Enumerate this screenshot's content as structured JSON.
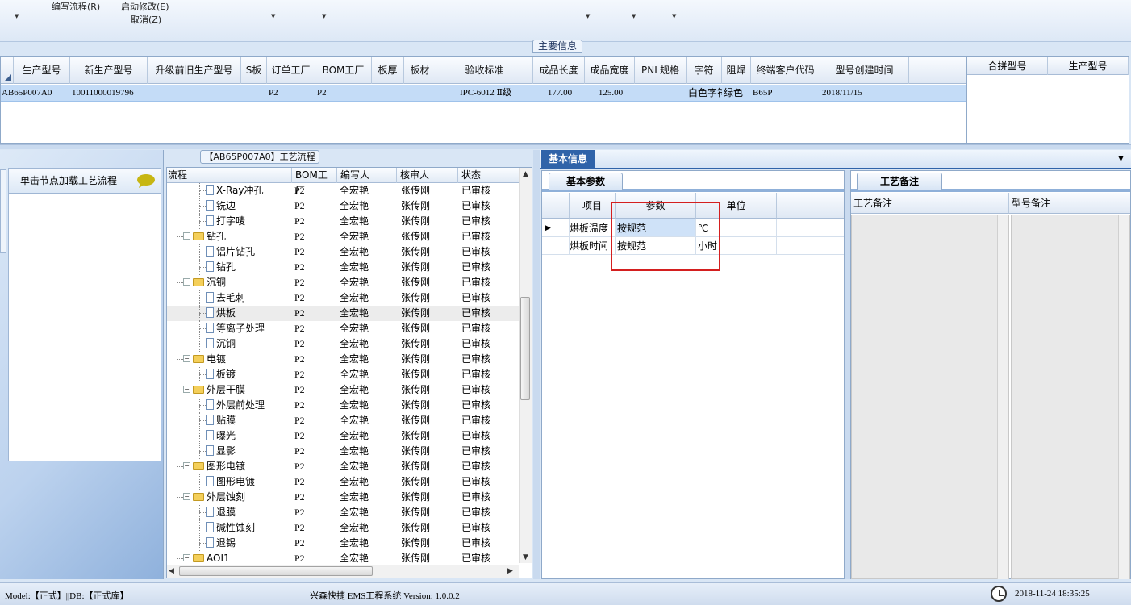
{
  "ribbon": {
    "menu1": "编写流程(R)",
    "menu2": "启动修改(E)",
    "menu3": "取消(Z)"
  },
  "main_info": {
    "section_title": "主要信息",
    "columns": [
      "生产型号",
      "新生产型号",
      "升级前旧生产型号",
      "S板",
      "订单工厂",
      "BOM工厂",
      "板厚",
      "板材",
      "验收标准",
      "成品长度",
      "成品宽度",
      "PNL规格",
      "字符",
      "阻焊",
      "终端客户代码",
      "型号创建时间"
    ],
    "row": {
      "c1": "AB65P007A0",
      "c2": "10011000019796",
      "c3": "",
      "c4": "",
      "c5": "P2",
      "c6": "P2",
      "c7": "",
      "c8": "",
      "c9": "IPC-6012 Ⅱ级",
      "c10": "177.00",
      "c11": "125.00",
      "c12": "",
      "c13": "白色字符",
      "c14": "绿色",
      "c15": "B65P",
      "c16": "2018/11/15"
    },
    "side_columns": [
      "合拼型号",
      "生产型号"
    ]
  },
  "left_panel": {
    "load_button": "单击节点加载工艺流程"
  },
  "tree": {
    "title": "【AB65P007A0】工艺流程",
    "columns": [
      "流程",
      "BOM工厂",
      "编写人",
      "核审人",
      "状态"
    ],
    "rows": [
      {
        "name": "X-Ray冲孔",
        "type": "leaf",
        "bom": "P2",
        "writer": "全宏艳",
        "reviewer": "张传刚",
        "status": "已审核"
      },
      {
        "name": "铣边",
        "type": "leaf",
        "bom": "P2",
        "writer": "全宏艳",
        "reviewer": "张传刚",
        "status": "已审核"
      },
      {
        "name": "打字唛",
        "type": "leaf",
        "bom": "P2",
        "writer": "全宏艳",
        "reviewer": "张传刚",
        "status": "已审核"
      },
      {
        "name": "钻孔",
        "type": "folder",
        "bom": "P2",
        "writer": "全宏艳",
        "reviewer": "张传刚",
        "status": "已审核"
      },
      {
        "name": "铝片钻孔",
        "type": "leaf",
        "bom": "P2",
        "writer": "全宏艳",
        "reviewer": "张传刚",
        "status": "已审核"
      },
      {
        "name": "钻孔",
        "type": "leaf",
        "bom": "P2",
        "writer": "全宏艳",
        "reviewer": "张传刚",
        "status": "已审核"
      },
      {
        "name": "沉铜",
        "type": "folder",
        "bom": "P2",
        "writer": "全宏艳",
        "reviewer": "张传刚",
        "status": "已审核"
      },
      {
        "name": "去毛刺",
        "type": "leaf",
        "bom": "P2",
        "writer": "全宏艳",
        "reviewer": "张传刚",
        "status": "已审核"
      },
      {
        "name": "烘板",
        "type": "leaf",
        "bom": "P2",
        "writer": "全宏艳",
        "reviewer": "张传刚",
        "status": "已审核",
        "selected": true
      },
      {
        "name": "等离子处理",
        "type": "leaf",
        "bom": "P2",
        "writer": "全宏艳",
        "reviewer": "张传刚",
        "status": "已审核"
      },
      {
        "name": "沉铜",
        "type": "leaf",
        "bom": "P2",
        "writer": "全宏艳",
        "reviewer": "张传刚",
        "status": "已审核"
      },
      {
        "name": "电镀",
        "type": "folder",
        "bom": "P2",
        "writer": "全宏艳",
        "reviewer": "张传刚",
        "status": "已审核"
      },
      {
        "name": "板镀",
        "type": "leaf",
        "bom": "P2",
        "writer": "全宏艳",
        "reviewer": "张传刚",
        "status": "已审核"
      },
      {
        "name": "外层干膜",
        "type": "folder",
        "bom": "P2",
        "writer": "全宏艳",
        "reviewer": "张传刚",
        "status": "已审核"
      },
      {
        "name": "外层前处理",
        "type": "leaf",
        "bom": "P2",
        "writer": "全宏艳",
        "reviewer": "张传刚",
        "status": "已审核"
      },
      {
        "name": "贴膜",
        "type": "leaf",
        "bom": "P2",
        "writer": "全宏艳",
        "reviewer": "张传刚",
        "status": "已审核"
      },
      {
        "name": "曝光",
        "type": "leaf",
        "bom": "P2",
        "writer": "全宏艳",
        "reviewer": "张传刚",
        "status": "已审核"
      },
      {
        "name": "显影",
        "type": "leaf",
        "bom": "P2",
        "writer": "全宏艳",
        "reviewer": "张传刚",
        "status": "已审核"
      },
      {
        "name": "图形电镀",
        "type": "folder",
        "bom": "P2",
        "writer": "全宏艳",
        "reviewer": "张传刚",
        "status": "已审核"
      },
      {
        "name": "图形电镀",
        "type": "leaf",
        "bom": "P2",
        "writer": "全宏艳",
        "reviewer": "张传刚",
        "status": "已审核"
      },
      {
        "name": "外层蚀刻",
        "type": "folder",
        "bom": "P2",
        "writer": "全宏艳",
        "reviewer": "张传刚",
        "status": "已审核"
      },
      {
        "name": "退膜",
        "type": "leaf",
        "bom": "P2",
        "writer": "全宏艳",
        "reviewer": "张传刚",
        "status": "已审核"
      },
      {
        "name": "碱性蚀刻",
        "type": "leaf",
        "bom": "P2",
        "writer": "全宏艳",
        "reviewer": "张传刚",
        "status": "已审核"
      },
      {
        "name": "退锡",
        "type": "leaf",
        "bom": "P2",
        "writer": "全宏艳",
        "reviewer": "张传刚",
        "status": "已审核"
      },
      {
        "name": "AOI1",
        "type": "folder",
        "bom": "P2",
        "writer": "全宏艳",
        "reviewer": "张传刚",
        "status": "已审核"
      }
    ]
  },
  "basic_info": {
    "tab": "基本信息",
    "params_tab": "基本参数",
    "columns": [
      "项目",
      "参数",
      "单位"
    ],
    "rows": [
      {
        "item": "烘板温度",
        "param": "按规范",
        "unit": "℃"
      },
      {
        "item": "烘板时间",
        "param": "按规范",
        "unit": "小时"
      }
    ]
  },
  "remarks": {
    "tab": "工艺备注",
    "col1": "工艺备注",
    "col2": "型号备注"
  },
  "status_bar": {
    "left": "Model:【正式】||DB:【正式库】",
    "center": "兴森快捷 EMS工程系统 Version: 1.0.0.2",
    "datetime": "2018-11-24 18:35:25"
  },
  "colors": {
    "accent": "#2f63a9",
    "selection": "#c4dcf7",
    "highlight_box": "#d41f1f"
  }
}
